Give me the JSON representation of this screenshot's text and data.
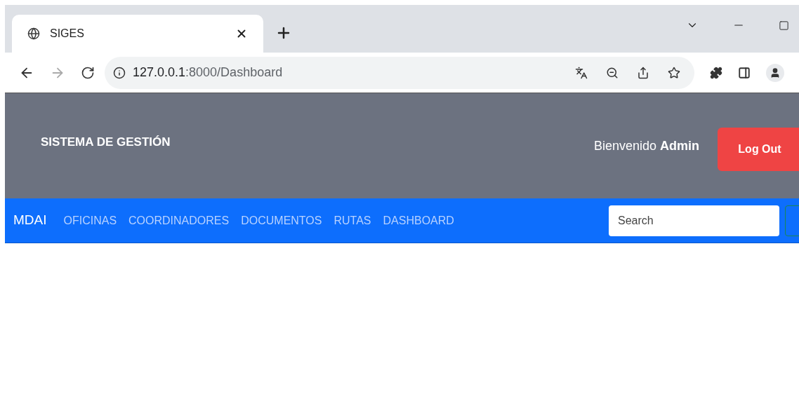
{
  "browser": {
    "tab": {
      "title": "SIGES",
      "selected": true
    },
    "url_host": "127.0.0.1",
    "url_path": ":8000/Dashboard"
  },
  "header": {
    "title": "SISTEMA DE GESTIÓN",
    "welcome": "Bienvenido **Admin**",
    "logout": "Log Out"
  },
  "navbar": {
    "brand": "MDAI",
    "links": [
      {
        "label": "OFICINAS",
        "selected": false
      },
      {
        "label": "COORDINADORES",
        "selected": false
      },
      {
        "label": "DOCUMENTOS",
        "selected": false
      },
      {
        "label": "RUTAS",
        "selected": false
      },
      {
        "label": "DASHBOARD",
        "selected": false
      }
    ],
    "search": {
      "placeholder": "Search"
    }
  }
}
